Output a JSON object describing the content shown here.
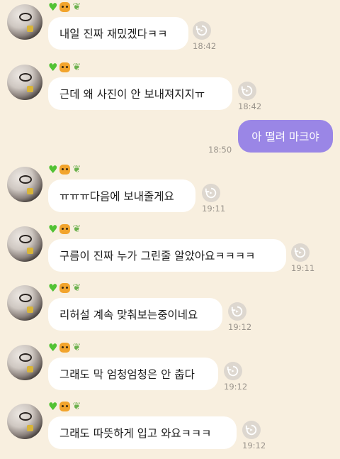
{
  "messages": [
    {
      "text": "내일 진짜 재밌겠다ㅋㅋ",
      "time": "18:42"
    },
    {
      "text": "근데 왜 사진이 안 보내져지지ㅠ",
      "time": "18:42"
    },
    {
      "text": "ㅠㅠㅠ다음에 보내줄게요",
      "time": "19:11"
    },
    {
      "text": "구름이 진짜 누가 그린줄 알았아요ㅋㅋㅋㅋ",
      "time": "19:11"
    },
    {
      "text": "리허설 계속 맞춰보는중이네요",
      "time": "19:12"
    },
    {
      "text": "그래도 막 엄청엄청은 안 춥다",
      "time": "19:12"
    },
    {
      "text": "그래도 따뜻하게 입고 와요ㅋㅋㅋ",
      "time": "19:12"
    }
  ],
  "outgoing": {
    "text": "아 떨려 마크야",
    "time": "18:50"
  },
  "emoji_badges": [
    "green-heart",
    "tiger-face",
    "seedling"
  ],
  "colors": {
    "background": "#f8efdf",
    "incoming_bubble": "#ffffff",
    "outgoing_bubble": "#9a86e6",
    "time_text": "#9b958d"
  }
}
